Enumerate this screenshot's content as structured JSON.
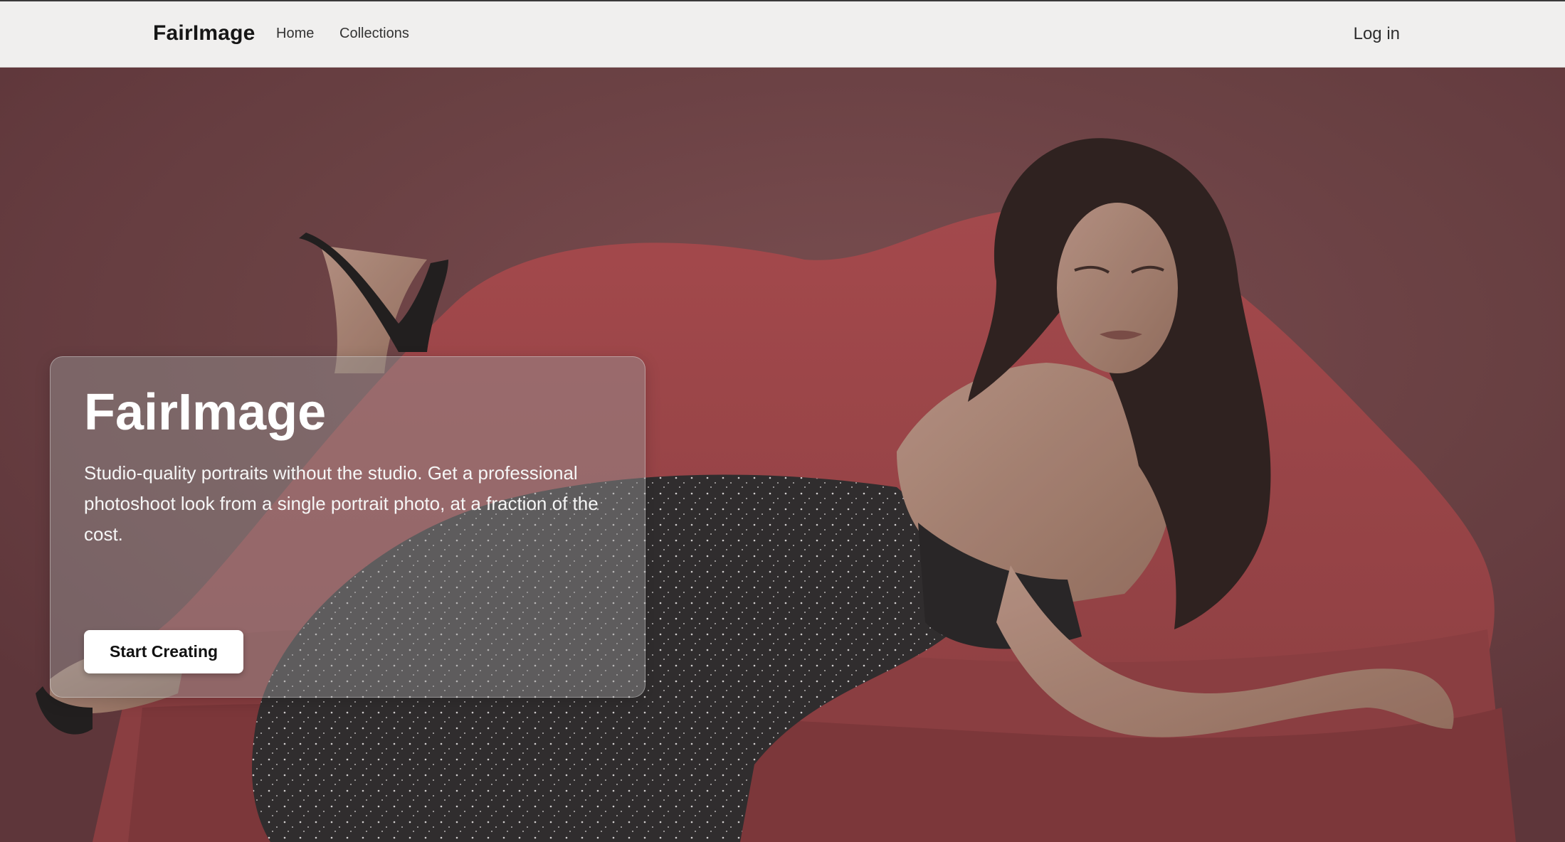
{
  "nav": {
    "brand": "FairImage",
    "links": [
      {
        "label": "Home"
      },
      {
        "label": "Collections"
      }
    ],
    "login": "Log in"
  },
  "hero": {
    "title": "FairImage",
    "description": "Studio-quality portraits without the studio. Get a professional photoshoot look from a single portrait photo, at a fraction of the cost.",
    "cta_label": "Start Creating"
  },
  "colors": {
    "navbar_bg": "#f0efee",
    "hero_backdrop": "#6e4145",
    "sofa_red": "#9e4a4c",
    "dress": "#2c2c2c",
    "button_bg": "#ffffff"
  }
}
